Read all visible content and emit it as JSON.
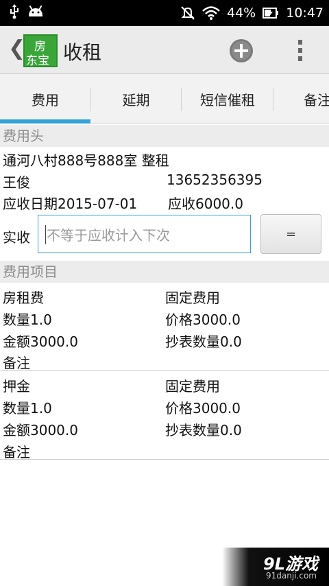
{
  "status_bar": {
    "battery": "44%",
    "time": "10:47"
  },
  "action_bar": {
    "logo_line1": "房",
    "logo_line2": "东宝",
    "title": "收租"
  },
  "tabs": [
    {
      "label": "费用",
      "selected": true
    },
    {
      "label": "延期",
      "selected": false
    },
    {
      "label": "短信催租",
      "selected": false
    },
    {
      "label": "备注",
      "selected": false
    }
  ],
  "fee_header": {
    "section_title": "费用头",
    "property": "通河八村888号888室 整租",
    "tenant_name": "王俊",
    "tenant_phone": "13652356395",
    "due_date": "应收日期2015-07-01",
    "due_amount": "应收6000.0"
  },
  "received": {
    "label": "实收",
    "placeholder": "不等于应收计入下次",
    "equals_label": "="
  },
  "fee_items": {
    "section_title": "费用项目",
    "items": [
      {
        "name": "房租费",
        "type": "固定费用",
        "quantity": "数量1.0",
        "price": "价格3000.0",
        "amount": "金额3000.0",
        "meter_quantity": "抄表数量0.0",
        "note": "备注"
      },
      {
        "name": "押金",
        "type": "固定费用",
        "quantity": "数量1.0",
        "price": "价格3000.0",
        "amount": "金额3000.0",
        "meter_quantity": "抄表数量0.0",
        "note": "备注"
      }
    ]
  },
  "watermark": {
    "brand": "9L游戏",
    "site": "91danji.com"
  },
  "colors": {
    "accent": "#33a2d9",
    "logo_green": "#3aa63a",
    "section_bg": "#ececec"
  }
}
